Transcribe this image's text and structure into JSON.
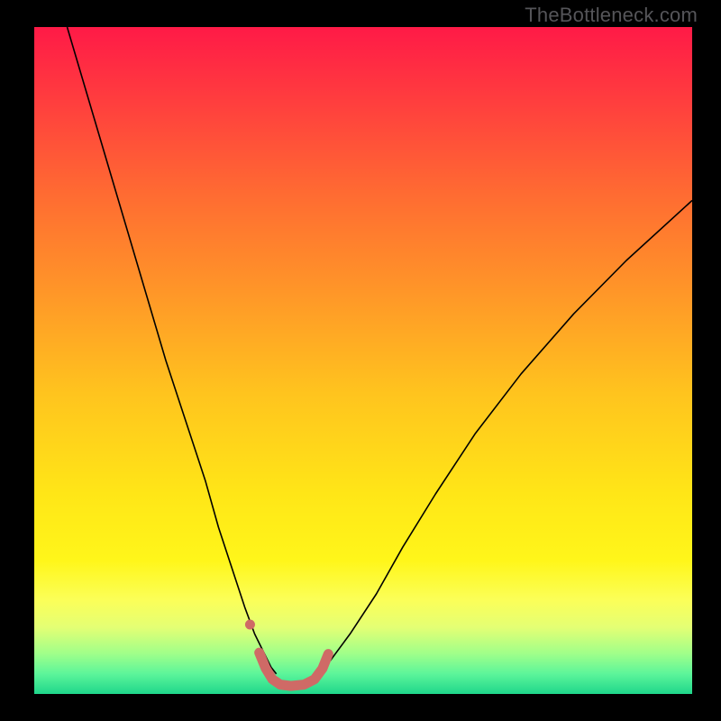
{
  "watermark": "TheBottleneck.com",
  "chart_data": {
    "type": "line",
    "title": "",
    "xlabel": "",
    "ylabel": "",
    "xlim": [
      0,
      100
    ],
    "ylim": [
      0,
      100
    ],
    "grid": false,
    "legend": false,
    "background_gradient": {
      "stops": [
        {
          "offset": 0.0,
          "color": "#ff1a47"
        },
        {
          "offset": 0.1,
          "color": "#ff3a3f"
        },
        {
          "offset": 0.25,
          "color": "#ff6b32"
        },
        {
          "offset": 0.4,
          "color": "#ff9728"
        },
        {
          "offset": 0.55,
          "color": "#ffc41e"
        },
        {
          "offset": 0.7,
          "color": "#ffe617"
        },
        {
          "offset": 0.8,
          "color": "#fff61a"
        },
        {
          "offset": 0.86,
          "color": "#fbff59"
        },
        {
          "offset": 0.9,
          "color": "#e4ff74"
        },
        {
          "offset": 0.94,
          "color": "#9fff8a"
        },
        {
          "offset": 0.97,
          "color": "#5cf59a"
        },
        {
          "offset": 1.0,
          "color": "#1fd68b"
        }
      ]
    },
    "series": [
      {
        "name": "curve-left",
        "color": "#000000",
        "width": 1.6,
        "x": [
          5,
          8,
          11,
          14,
          17,
          20,
          23,
          26,
          28,
          30,
          32,
          33.5,
          35,
          36,
          36.8
        ],
        "y": [
          100,
          90,
          80,
          70,
          60,
          50,
          41,
          32,
          25,
          19,
          13,
          9,
          6,
          4,
          3
        ]
      },
      {
        "name": "curve-right",
        "color": "#000000",
        "width": 1.6,
        "x": [
          43,
          45,
          48,
          52,
          56,
          61,
          67,
          74,
          82,
          90,
          100
        ],
        "y": [
          3,
          5,
          9,
          15,
          22,
          30,
          39,
          48,
          57,
          65,
          74
        ]
      },
      {
        "name": "bottom-red-segment",
        "color": "#cf6a66",
        "width": 11,
        "linecap": "round",
        "x": [
          34.2,
          35.2,
          36.2,
          37.4,
          39.0,
          41.0,
          42.6,
          43.8,
          44.7
        ],
        "y": [
          6.2,
          3.8,
          2.2,
          1.4,
          1.2,
          1.4,
          2.2,
          3.8,
          6.0
        ]
      },
      {
        "name": "bottom-red-dot",
        "type": "scatter",
        "color": "#cf6a66",
        "radius": 5.5,
        "x": [
          32.8
        ],
        "y": [
          10.4
        ]
      }
    ]
  }
}
